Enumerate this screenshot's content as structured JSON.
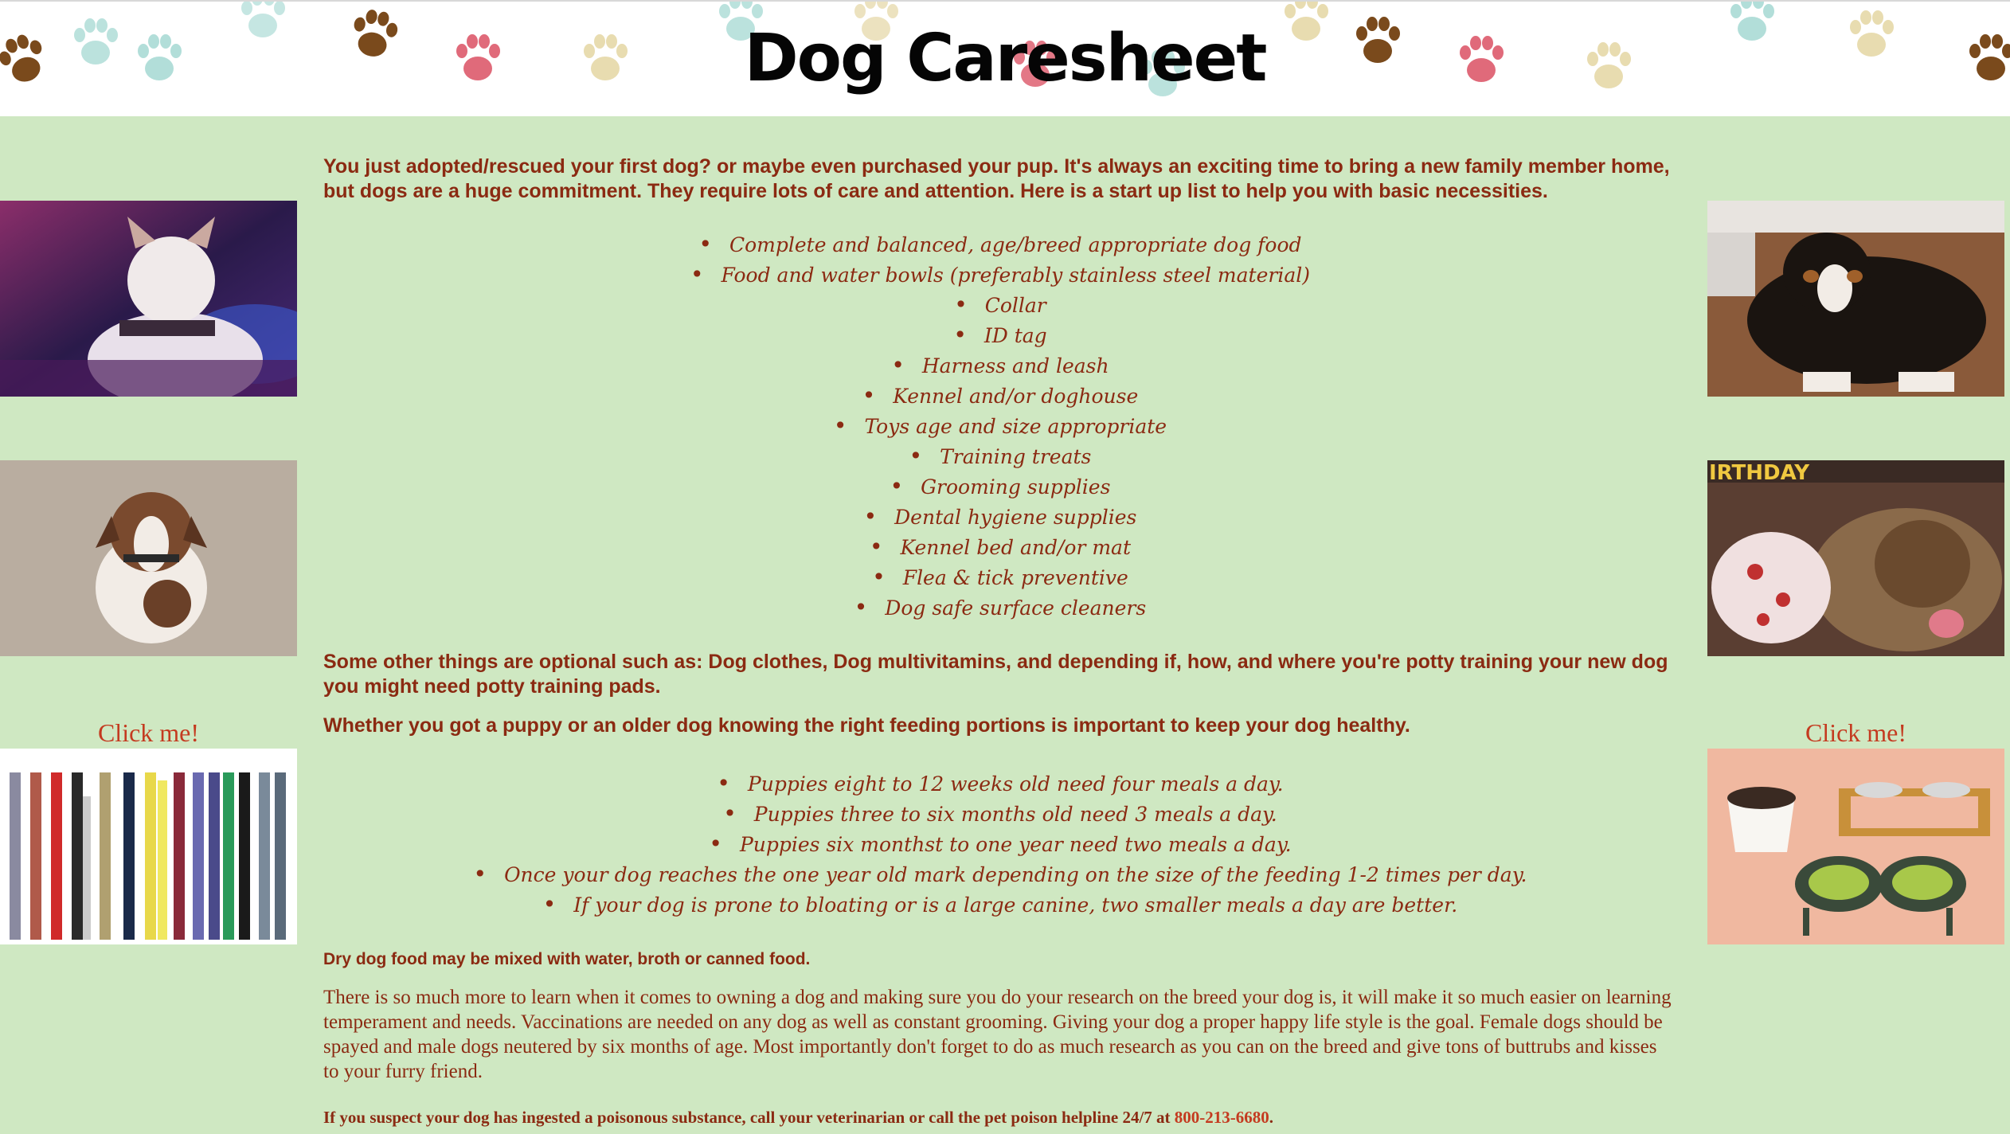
{
  "header": {
    "title": "Dog Caresheet"
  },
  "left_images": [
    {
      "name": "husky-puppy-photo"
    },
    {
      "name": "puppy-on-carpet-photo"
    },
    {
      "name": "dog-collars-photo",
      "click_label": "Click me!"
    }
  ],
  "right_images": [
    {
      "name": "bernese-puppy-photo"
    },
    {
      "name": "yorkie-birthday-photo",
      "banner_text": "IRTHDAY"
    },
    {
      "name": "dog-bowls-photo",
      "click_label": "Click me!"
    }
  ],
  "intro": "You just adopted/rescued your first dog? or maybe even purchased your pup. It's always an exciting time to bring a new family member home, but dogs are a huge commitment. They require lots of care and attention. Here is a start up list to help you with basic necessities.",
  "necessities": [
    "Complete and balanced, age/breed appropriate dog food",
    "Food and water bowls (preferably stainless steel material)",
    "Collar",
    "ID tag",
    "Harness and leash",
    "Kennel and/or doghouse",
    "Toys age and size appropriate",
    "Training treats",
    "Grooming supplies",
    "Dental hygiene supplies",
    "Kennel bed and/or mat",
    "Flea & tick preventive",
    "Dog safe surface cleaners"
  ],
  "optional_text": "Some other things are optional such as: Dog clothes, Dog multivitamins, and depending if, how, and where you're potty training your new dog you might need potty training pads.",
  "feeding_intro": "Whether you got a puppy or an older dog knowing the right feeding portions is important to keep your dog healthy.",
  "feeding_list": [
    "Puppies eight to 12 weeks old need four meals a day.",
    "Puppies three to six months old need 3 meals a day.",
    "Puppies six monthst to one year need two meals a day.",
    "Once your dog reaches the one year old mark depending on the size of the feeding 1-2 times per day.",
    "If your dog is prone to bloating or is a large canine, two smaller meals a day are better."
  ],
  "dry_food_note": "Dry dog food may be mixed with water, broth or canned food.",
  "closing_paragraph": "There is so much more to learn when it comes to owning a dog and making sure you do your research on the breed your dog is, it will make it so much easier on learning temperament and needs. Vaccinations are needed on any dog as well as constant grooming. Giving your dog a proper happy life style is the goal. Female dogs should be spayed and male dogs neutered by six months of age. Most importantly don't forget to do as much research as you can on the breed and give tons of buttrubs and kisses to your furry friend.",
  "poison_warning": {
    "text": "If you suspect your dog has ingested a poisonous substance, call your veterinarian or call the pet poison helpline 24/7 at ",
    "phone": "800-213-6680",
    "end": "."
  },
  "colors": {
    "background": "#cfe8c2",
    "text": "#8b2a12",
    "accent": "#c43a1f"
  }
}
